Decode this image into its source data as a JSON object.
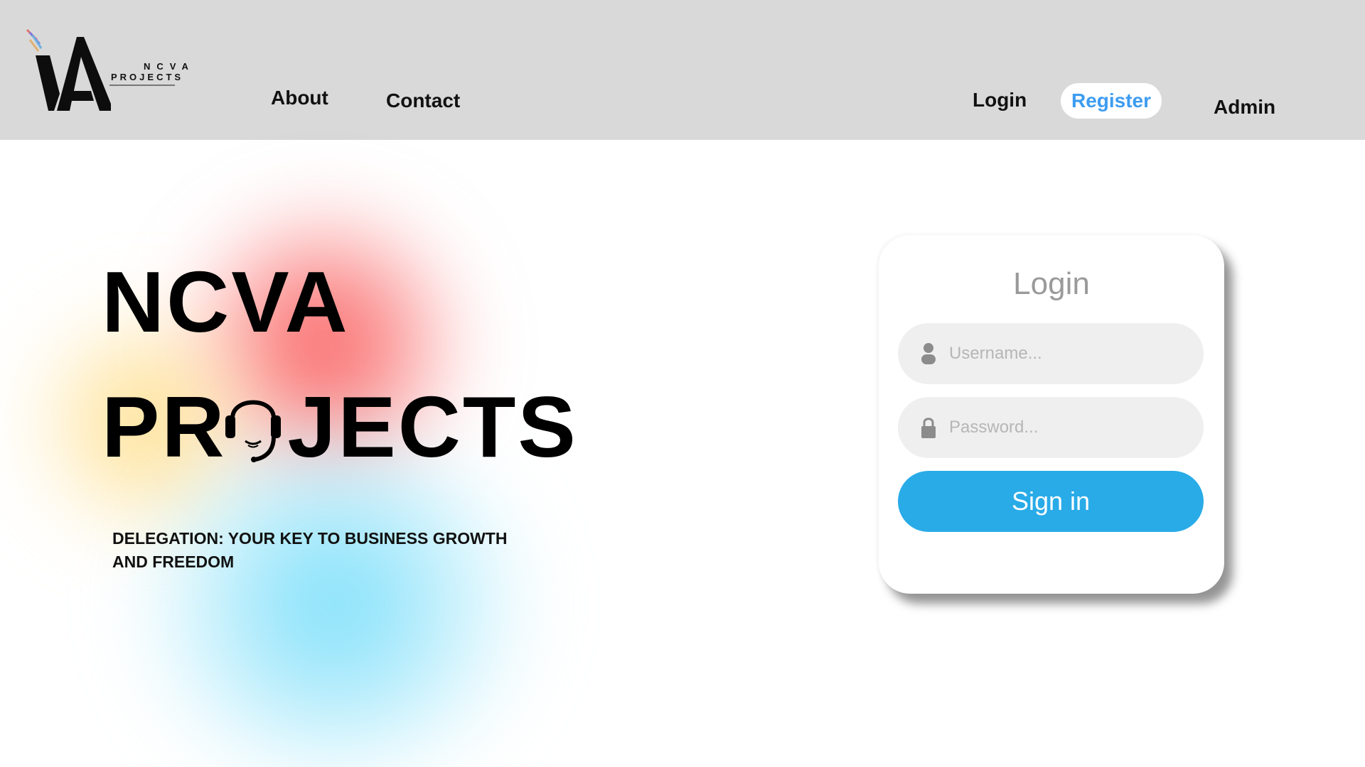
{
  "brand": {
    "logo_line1": "NCVA",
    "logo_line2": "PROJECTS"
  },
  "nav": {
    "about": "About",
    "contact": "Contact",
    "login": "Login",
    "register": "Register",
    "admin": "Admin"
  },
  "hero": {
    "title_line1": "NCVA",
    "title_line2_before": "PR",
    "title_line2_after": "JECTS",
    "tagline": "DELEGATION: YOUR KEY TO BUSINESS GROWTH AND FREEDOM"
  },
  "login_form": {
    "heading": "Login",
    "username_placeholder": "Username...",
    "password_placeholder": "Password...",
    "submit_label": "Sign in"
  },
  "icons": {
    "user": "person-icon",
    "password": "lock-icon",
    "headset": "headset-icon"
  },
  "colors": {
    "header_bg": "#d9d9d9",
    "register_text": "#3d9cf0",
    "signin_button": "#29abe8"
  }
}
